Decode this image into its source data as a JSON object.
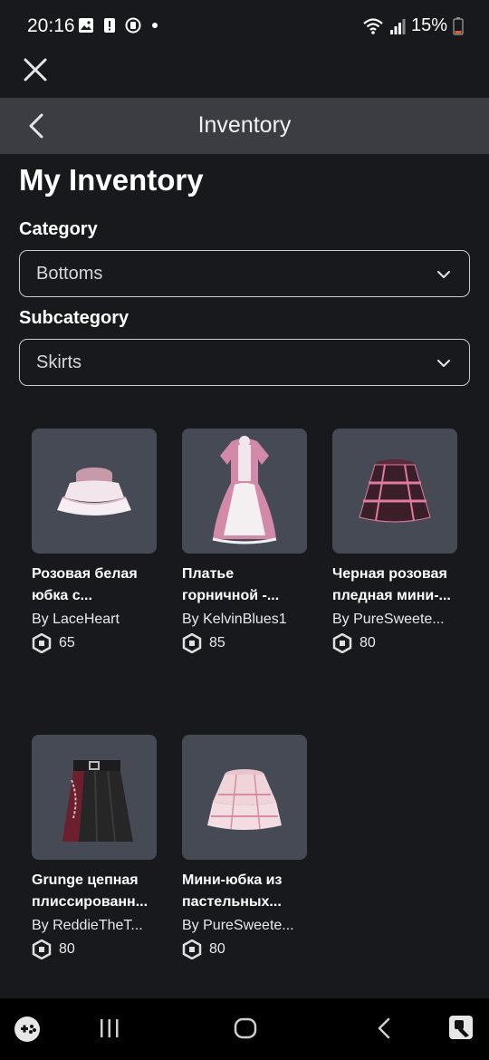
{
  "status_bar": {
    "time": "20:16",
    "battery": "15%",
    "icons": [
      "image-icon",
      "alert-icon",
      "record-icon",
      "notification-dot",
      "wifi-icon",
      "signal-icon",
      "battery-icon"
    ]
  },
  "header": {
    "title": "Inventory"
  },
  "page": {
    "title": "My Inventory",
    "category_label": "Category",
    "category_value": "Bottoms",
    "subcategory_label": "Subcategory",
    "subcategory_value": "Skirts"
  },
  "items": [
    {
      "name": "Розовая белая юбка с...",
      "creator": "By LaceHeart",
      "price": "65"
    },
    {
      "name": "Платье горничной -...",
      "creator": "By KelvinBlues1",
      "price": "85"
    },
    {
      "name": "Черная розовая пледная мини-...",
      "creator": "By PureSweete...",
      "price": "80"
    },
    {
      "name": "Grunge цепная плиссированн...",
      "creator": "By ReddieTheT...",
      "price": "80"
    },
    {
      "name": "Мини-юбка из пастельных...",
      "creator": "By PureSweete...",
      "price": "80"
    }
  ],
  "colors": {
    "background": "#18191d",
    "header": "#3b3d43",
    "thumb_background": "#464a55",
    "nav_bar": "#000000"
  },
  "nav_bar": {
    "icons": [
      "game-controller-icon",
      "recents-icon",
      "home-icon",
      "back-icon",
      "app-icon"
    ]
  }
}
